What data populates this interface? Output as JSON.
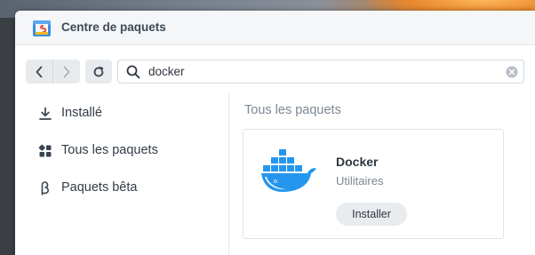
{
  "window": {
    "title": "Centre de paquets",
    "app_icon": "package-center-icon"
  },
  "toolbar": {
    "back_icon": "chevron-left-icon",
    "forward_icon": "chevron-right-icon",
    "refresh_icon": "refresh-icon",
    "search": {
      "icon": "search-icon",
      "value": "docker",
      "clear_icon": "clear-icon"
    }
  },
  "sidebar": {
    "items": [
      {
        "label": "Installé",
        "icon": "download-icon"
      },
      {
        "label": "Tous les paquets",
        "icon": "grid-icon"
      },
      {
        "label": "Paquets bêta",
        "icon": "beta-icon"
      }
    ]
  },
  "main": {
    "section_title": "Tous les paquets",
    "packages": [
      {
        "name": "Docker",
        "category": "Utilitaires",
        "action_label": "Installer",
        "icon": "docker-whale-icon"
      }
    ]
  },
  "colors": {
    "accent": "#1d91e8",
    "window_bg": "#ffffff",
    "titlebar_bg": "#f5f6f7",
    "text_primary": "#333c47",
    "text_secondary": "#7b8794"
  }
}
